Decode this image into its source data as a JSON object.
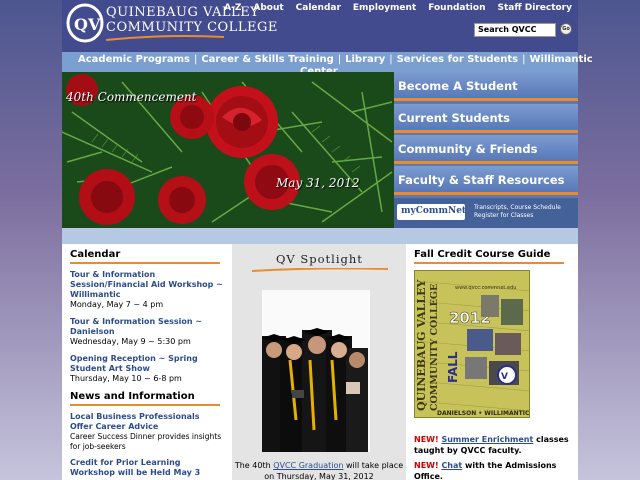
{
  "header": {
    "logo_line1": "QUINEBAUG VALLEY",
    "logo_line2": "COMMUNITY COLLEGE",
    "logo_letters": "QV",
    "top_links": [
      "A-Z",
      "About",
      "Calendar",
      "Employment",
      "Foundation",
      "Staff Directory"
    ],
    "search_value": "Search QVCC",
    "search_button": "Go"
  },
  "nav": {
    "items": [
      "Academic Programs",
      "Career & Skills Training",
      "Library",
      "Services for Students",
      "Willimantic"
    ],
    "center_label": "Center"
  },
  "hero": {
    "title": "40th Commencement",
    "date": "May 31, 2012"
  },
  "right_menu": {
    "buttons": [
      "Become A Student",
      "Current Students",
      "Community & Friends",
      "Faculty & Staff Resources"
    ],
    "mycommnet_label": "myCommNet",
    "mycommnet_desc": "Transcripts, Course Schedule Register for Classes"
  },
  "calendar": {
    "heading": "Calendar",
    "events": [
      {
        "title": "Tour & Information Session/Financial Aid Workshop ~ Willimantic",
        "date": "Monday, May 7 ~ 4 pm"
      },
      {
        "title": "Tour & Information Session ~ Danielson",
        "date": "Wednesday, May 9 ~ 5:30 pm"
      },
      {
        "title": "Opening Reception ~ Spring Student Art Show",
        "date": "Thursday, May 10 ~ 6-8 pm"
      }
    ]
  },
  "news": {
    "heading": "News and Information",
    "items": [
      {
        "title": "Local Business Professionals Offer Career Advice",
        "desc": "Career Success Dinner provides insights for job-seekers"
      },
      {
        "title": "Credit for Prior Learning Workshop will be Held May 3",
        "desc": ""
      }
    ]
  },
  "spotlight": {
    "heading": "QV Spotlight",
    "caption_pre": "The 40th",
    "caption_link": "QVCC Graduation",
    "caption_post": "will take place on Thursday, May 31, 2012"
  },
  "course_guide": {
    "heading": "Fall Credit Course Guide",
    "cover_title": "QUINEBAUG VALLEY",
    "cover_subtitle": "COMMUNITY COLLEGE",
    "cover_year": "2012",
    "cover_season": "FALL",
    "cover_locations": "DANIELSON • WILLIMANTIC",
    "cover_url": "www.qvcc.commnet.edu",
    "promo1_new": "NEW!",
    "promo1_link": "Summer Enrichment",
    "promo1_text": "classes taught by QVCC faculty.",
    "promo2_new": "NEW!",
    "promo2_link": "Chat",
    "promo2_text": "with the Admissions Office."
  },
  "colors": {
    "header_bg": "#434b8f",
    "nav_bg": "#7a9fd0",
    "accent_orange": "#e98c2e",
    "link_blue": "#2d4c8e",
    "new_red": "#cc0000"
  }
}
